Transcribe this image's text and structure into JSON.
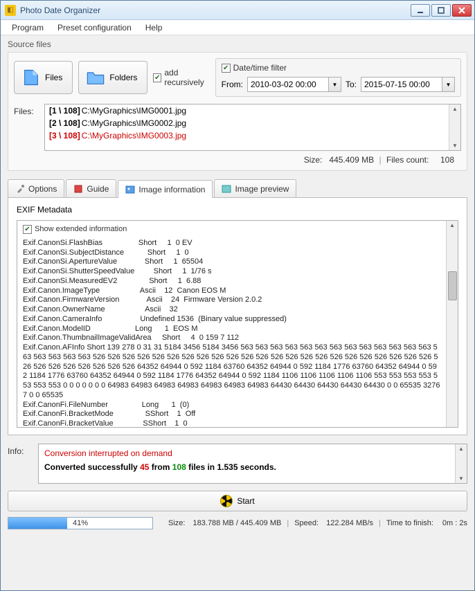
{
  "title": "Photo Date Organizer",
  "menu": {
    "program": "Program",
    "preset": "Preset configuration",
    "help": "Help"
  },
  "source": {
    "label": "Source files",
    "files_btn": "Files",
    "folders_btn": "Folders",
    "add_recursively": "add recursively",
    "filter_label": "Date/time filter",
    "from_label": "From:",
    "to_label": "To:",
    "from_value": "2010-03-02 00:00",
    "to_value": "2015-07-15 00:00",
    "files_label": "Files:",
    "items": [
      {
        "idx": "[1 \\ 108]",
        "path": "C:\\MyGraphics\\IMG0001.jpg",
        "selected": false
      },
      {
        "idx": "[2 \\ 108]",
        "path": "C:\\MyGraphics\\IMG0002.jpg",
        "selected": false
      },
      {
        "idx": "[3 \\ 108]",
        "path": "C:\\MyGraphics\\IMG0003.jpg",
        "selected": true
      }
    ],
    "size_label": "Size:",
    "size_value": "445.409 MB",
    "count_label": "Files count:",
    "count_value": "108"
  },
  "tabs": {
    "options": "Options",
    "guide": "Guide",
    "image_info": "Image information",
    "image_preview": "Image preview"
  },
  "exif": {
    "section_label": "EXIF Metadata",
    "show_extended": "Show extended information",
    "lines": [
      "Exif.CanonSi.FlashBias                 Short     1  0 EV",
      "Exif.CanonSi.SubjectDistance           Short     1  0",
      "Exif.CanonSi.ApertureValue             Short     1  65504",
      "Exif.CanonSi.ShutterSpeedValue         Short     1  1/76 s",
      "Exif.CanonSi.MeasuredEV2               Short     1  6.88",
      "Exif.Canon.ImageType                   Ascii    12  Canon EOS M",
      "Exif.Canon.FirmwareVersion             Ascii    24  Firmware Version 2.0.2",
      "Exif.Canon.OwnerName                   Ascii    32",
      "Exif.Canon.CameraInfo                  Undefined 1536  (Binary value suppressed)",
      "Exif.Canon.ModelID                     Long      1  EOS M",
      "Exif.Canon.ThumbnailImageValidArea     Short     4  0 159 7 112"
    ],
    "afinfo_prefix": "Exif.Canon.AFInfo                      Short   139  ",
    "afinfo_blob": "278 0 31 31 5184 3456 5184 3456 563 563 563 563 563 563 563 563 563 563 563 563 563 563 563 563 563 563 526 526 526 526 526 526 526 526 526 526 526 526 526 526 526 526 526 526 526 526 526 526 526 526 526 526 526 526 526 526 526 64352 64944 0 592 1184 63760 64352 64944 0 592 1184 1776 63760 64352 64944 0 592 1184 1776 63760 64352 64944 0 592 1184 1776 64352 64944 0 592 1184 1106 1106 1106 1106 1106 553 553 553 553 553 553 553 0 0 0 0 0 0 0 64983 64983 64983 64983 64983 64983 64983 64430 64430 64430 64430 64430 0 0 65535 32767 0 0 65535",
    "tail": [
      "Exif.CanonFi.FileNumber                Long      1  (0)",
      "Exif.CanonFi.BracketMode               SShort    1  Off",
      "Exif.CanonFi.BracketValue              SShort    1  0"
    ]
  },
  "info": {
    "label": "Info:",
    "interrupted": "Conversion interrupted on demand",
    "converted_prefix": "Converted successfully ",
    "converted_n": "45",
    "converted_mid": " from ",
    "converted_total": "108",
    "converted_suffix": " files in 1.535 seconds."
  },
  "start": "Start",
  "status": {
    "pct": "41%",
    "size_label": "Size:",
    "size_value": "183.788 MB  /  445.409 MB",
    "speed_label": "Speed:",
    "speed_value": "122.284 MB/s",
    "ttf_label": "Time to finish:",
    "ttf_value": "0m : 2s"
  }
}
